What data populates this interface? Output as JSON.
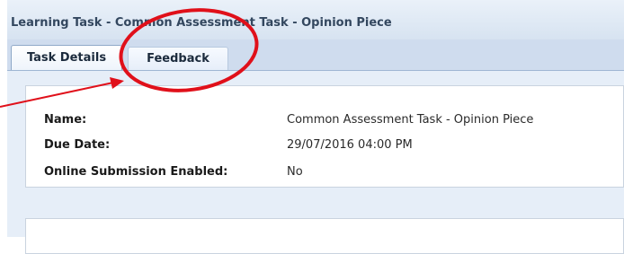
{
  "window": {
    "title": "Learning Task - Common Assessment Task - Opinion Piece"
  },
  "tabs": [
    {
      "label": "Task Details",
      "active": true
    },
    {
      "label": "Feedback",
      "active": false
    }
  ],
  "details": {
    "name_label": "Name:",
    "name_value": "Common Assessment Task - Opinion Piece",
    "due_label": "Due Date:",
    "due_value": "29/07/2016 04:00 PM",
    "online_label": "Online Submission Enabled:",
    "online_value": "No"
  },
  "annotation": {
    "color": "#e0101a"
  }
}
